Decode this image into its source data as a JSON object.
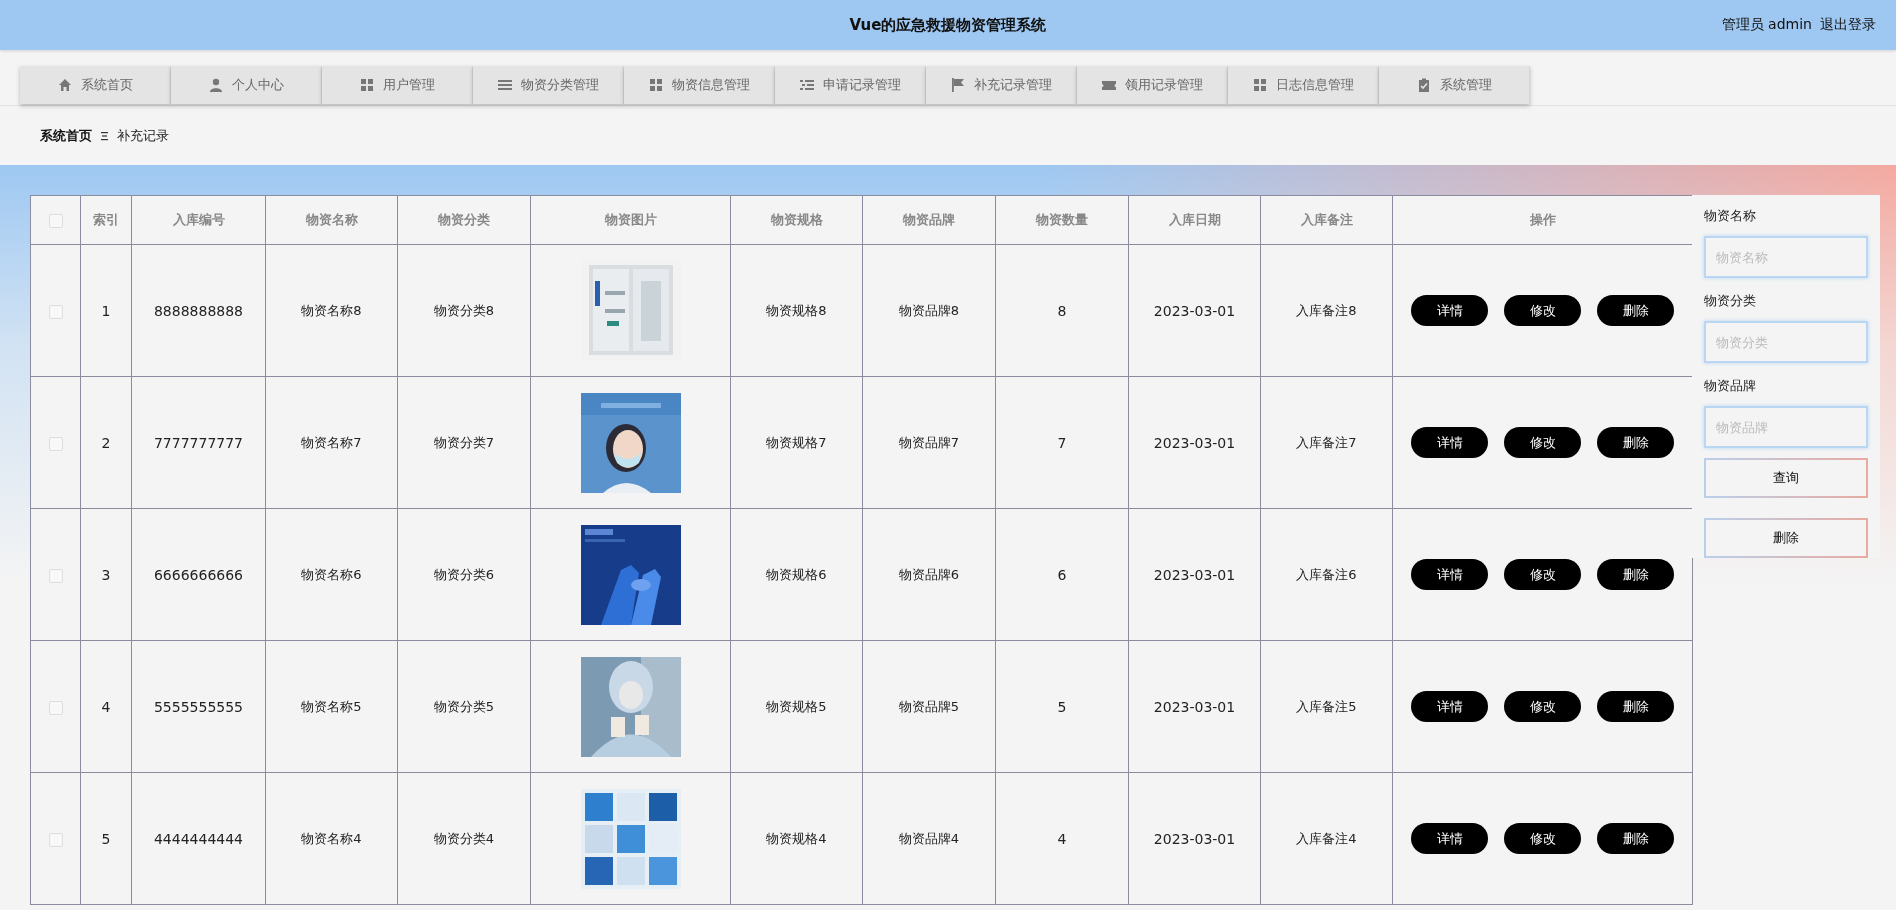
{
  "header": {
    "title": "Vue的应急救援物资管理系统",
    "user": "管理员 admin",
    "logout": "退出登录"
  },
  "nav": [
    {
      "label": "系统首页",
      "selected": false
    },
    {
      "label": "个人中心",
      "selected": false
    },
    {
      "label": "用户管理",
      "selected": false
    },
    {
      "label": "物资分类管理",
      "selected": false
    },
    {
      "label": "物资信息管理",
      "selected": false
    },
    {
      "label": "申请记录管理",
      "selected": false
    },
    {
      "label": "补充记录管理",
      "selected": false
    },
    {
      "label": "领用记录管理",
      "selected": false
    },
    {
      "label": "日志信息管理",
      "selected": false
    },
    {
      "label": "系统管理",
      "selected": false
    }
  ],
  "breadcrumb": [
    "系统首页",
    "补充记录"
  ],
  "table": {
    "select_all_checked": false,
    "columns": [
      "索引",
      "入库编号",
      "物资名称",
      "物资分类",
      "物资图片",
      "物资规格",
      "物资品牌",
      "物资数量",
      "入库日期",
      "入库备注",
      "操作"
    ],
    "rows": [
      {
        "checked": false,
        "cells": [
          "1",
          "8888888888",
          "物资名称8",
          "物资分类8",
          {
            "kind": "picture"
          },
          "物资规格8",
          "物资品牌8",
          "8",
          "2023-03-01",
          "入库备注8"
        ],
        "actions": [
          "详情",
          "修改",
          "删除"
        ]
      },
      {
        "checked": false,
        "cells": [
          "2",
          "7777777777",
          "物资名称7",
          "物资分类7",
          {
            "kind": "picture"
          },
          "物资规格7",
          "物资品牌7",
          "7",
          "2023-03-01",
          "入库备注7"
        ],
        "actions": [
          "详情",
          "修改",
          "删除"
        ]
      },
      {
        "checked": false,
        "cells": [
          "3",
          "6666666666",
          "物资名称6",
          "物资分类6",
          {
            "kind": "picture"
          },
          "物资规格6",
          "物资品牌6",
          "6",
          "2023-03-01",
          "入库备注6"
        ],
        "actions": [
          "详情",
          "修改",
          "删除"
        ]
      },
      {
        "checked": false,
        "cells": [
          "4",
          "5555555555",
          "物资名称5",
          "物资分类5",
          {
            "kind": "picture"
          },
          "物资规格5",
          "物资品牌5",
          "5",
          "2023-03-01",
          "入库备注5"
        ],
        "actions": [
          "详情",
          "修改",
          "删除"
        ]
      },
      {
        "checked": false,
        "cells": [
          "5",
          "4444444444",
          "物资名称4",
          "物资分类4",
          {
            "kind": "picture"
          },
          "物资规格4",
          "物资品牌4",
          "4",
          "2023-03-01",
          "入库备注4"
        ],
        "actions": [
          "详情",
          "修改",
          "删除"
        ]
      }
    ]
  },
  "search": {
    "fields": [
      {
        "label": "物资名称",
        "placeholder": "物资名称"
      },
      {
        "label": "物资分类",
        "placeholder": "物资分类"
      },
      {
        "label": "物资品牌",
        "placeholder": "物资品牌"
      }
    ],
    "buttons": [
      "查询",
      "删除"
    ]
  }
}
